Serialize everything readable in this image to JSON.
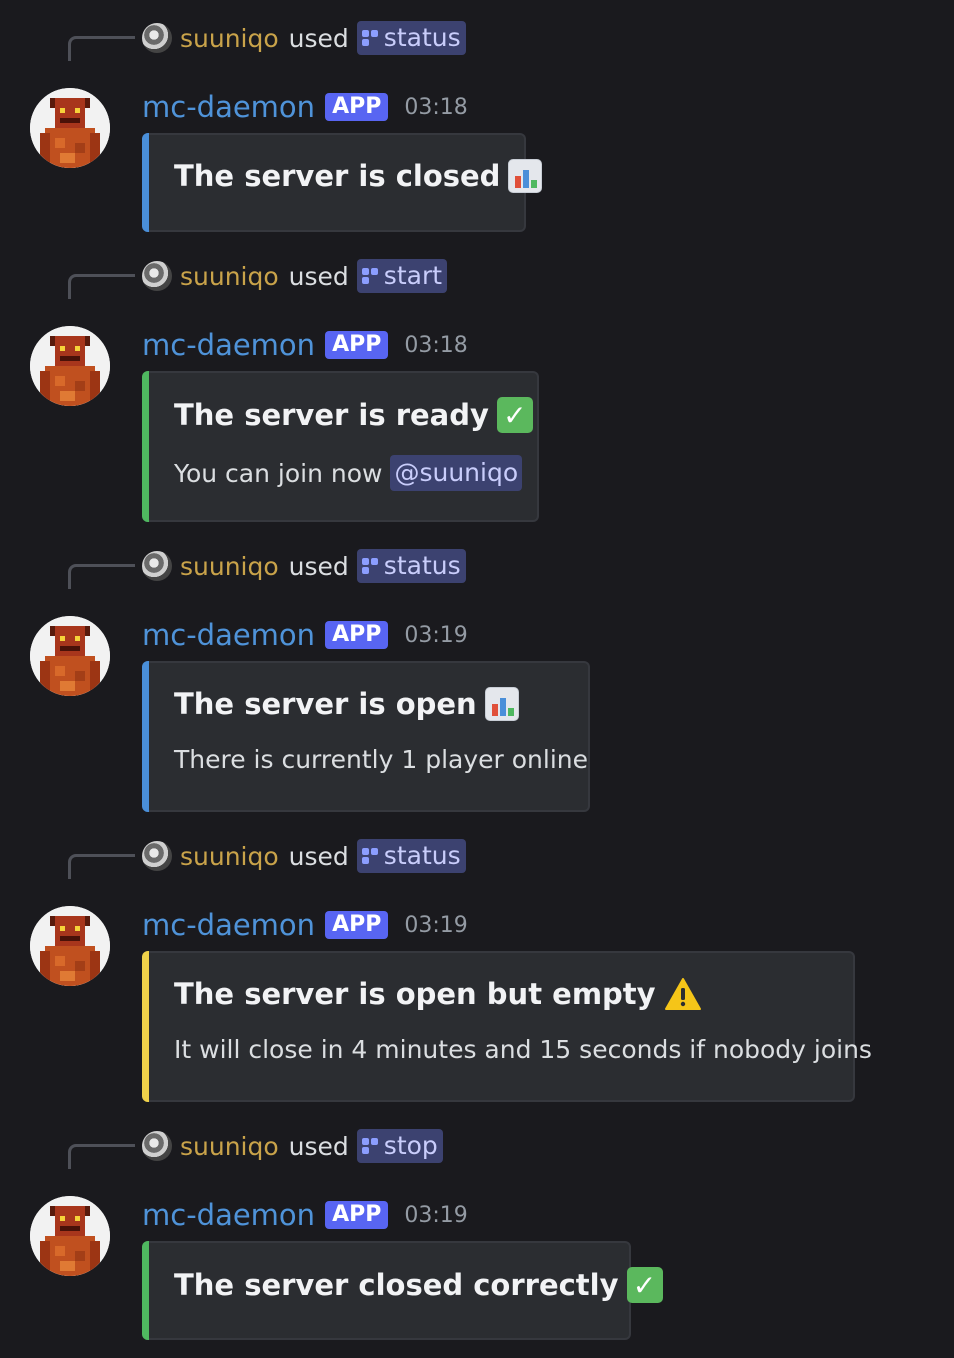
{
  "colors": {
    "background": "#1a1a1e",
    "embed_background": "#2b2d31",
    "bar_blue": "#4a8fd9",
    "bar_green": "#4fb860",
    "bar_yellow": "#f0d24a",
    "app_badge": "#5865f2",
    "bot_name": "#4f93d9",
    "reply_user": "#c9a34a",
    "command_chip": "#3c4270"
  },
  "messages": [
    {
      "reply": {
        "user": "suuniqo",
        "used_text": "used",
        "command": "status"
      },
      "author": {
        "name": "mc-daemon",
        "badge": "APP",
        "time": "03:18"
      },
      "embed": {
        "color": "blue",
        "title": "The server is closed",
        "emoji": "bar-chart-icon",
        "description": null
      }
    },
    {
      "reply": {
        "user": "suuniqo",
        "used_text": "used",
        "command": "start"
      },
      "author": {
        "name": "mc-daemon",
        "badge": "APP",
        "time": "03:18"
      },
      "embed": {
        "color": "green",
        "title": "The server is ready",
        "emoji": "check-mark-icon",
        "description": "You can join now",
        "mention": "@suuniqo"
      }
    },
    {
      "reply": {
        "user": "suuniqo",
        "used_text": "used",
        "command": "status"
      },
      "author": {
        "name": "mc-daemon",
        "badge": "APP",
        "time": "03:19"
      },
      "embed": {
        "color": "blue",
        "title": "The server is open",
        "emoji": "bar-chart-icon",
        "description": "There is currently 1 player online"
      }
    },
    {
      "reply": {
        "user": "suuniqo",
        "used_text": "used",
        "command": "status"
      },
      "author": {
        "name": "mc-daemon",
        "badge": "APP",
        "time": "03:19"
      },
      "embed": {
        "color": "yellow",
        "title": "The server is open but empty",
        "emoji": "warning-icon",
        "description": "It will close in 4 minutes and 15 seconds if nobody joins"
      }
    },
    {
      "reply": {
        "user": "suuniqo",
        "used_text": "used",
        "command": "stop"
      },
      "author": {
        "name": "mc-daemon",
        "badge": "APP",
        "time": "03:19"
      },
      "embed": {
        "color": "green",
        "title": "The server closed correctly",
        "emoji": "check-mark-icon",
        "description": null
      }
    }
  ]
}
